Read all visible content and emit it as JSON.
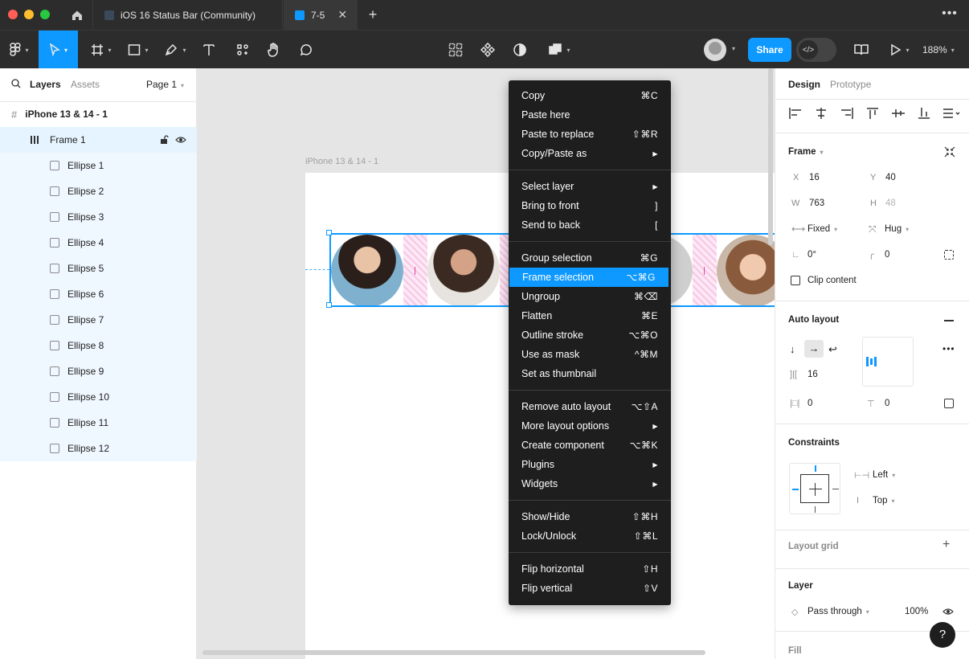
{
  "window": {
    "tabs": [
      {
        "label": "iOS 16 Status Bar (Community)",
        "active": false
      },
      {
        "label": "7-5",
        "active": true
      }
    ]
  },
  "toolbar": {
    "share_label": "Share",
    "zoom": "188%"
  },
  "layers_panel": {
    "tab_layers": "Layers",
    "tab_assets": "Assets",
    "page": "Page 1",
    "root": "iPhone 13 & 14 - 1",
    "frame": "Frame 1",
    "items": [
      "Ellipse 1",
      "Ellipse 2",
      "Ellipse 3",
      "Ellipse 4",
      "Ellipse 5",
      "Ellipse 6",
      "Ellipse 7",
      "Ellipse 8",
      "Ellipse 9",
      "Ellipse 10",
      "Ellipse 11",
      "Ellipse 12"
    ]
  },
  "canvas": {
    "frame_label": "iPhone 13 & 14 - 1"
  },
  "context_menu": {
    "groups": [
      [
        {
          "label": "Copy",
          "shortcut": "⌘C"
        },
        {
          "label": "Paste here",
          "shortcut": ""
        },
        {
          "label": "Paste to replace",
          "shortcut": "⇧⌘R"
        },
        {
          "label": "Copy/Paste as",
          "shortcut": "▶"
        }
      ],
      [
        {
          "label": "Select layer",
          "shortcut": "▶"
        },
        {
          "label": "Bring to front",
          "shortcut": "]"
        },
        {
          "label": "Send to back",
          "shortcut": "["
        }
      ],
      [
        {
          "label": "Group selection",
          "shortcut": "⌘G"
        },
        {
          "label": "Frame selection",
          "shortcut": "⌥⌘G",
          "highlighted": true
        },
        {
          "label": "Ungroup",
          "shortcut": "⌘⌫"
        },
        {
          "label": "Flatten",
          "shortcut": "⌘E"
        },
        {
          "label": "Outline stroke",
          "shortcut": "⌥⌘O"
        },
        {
          "label": "Use as mask",
          "shortcut": "^⌘M"
        },
        {
          "label": "Set as thumbnail",
          "shortcut": ""
        }
      ],
      [
        {
          "label": "Remove auto layout",
          "shortcut": "⌥⇧A"
        },
        {
          "label": "More layout options",
          "shortcut": "▶"
        },
        {
          "label": "Create component",
          "shortcut": "⌥⌘K"
        },
        {
          "label": "Plugins",
          "shortcut": "▶"
        },
        {
          "label": "Widgets",
          "shortcut": "▶"
        }
      ],
      [
        {
          "label": "Show/Hide",
          "shortcut": "⇧⌘H"
        },
        {
          "label": "Lock/Unlock",
          "shortcut": "⇧⌘L"
        }
      ],
      [
        {
          "label": "Flip horizontal",
          "shortcut": "⇧H"
        },
        {
          "label": "Flip vertical",
          "shortcut": "⇧V"
        }
      ]
    ]
  },
  "design_panel": {
    "tab_design": "Design",
    "tab_prototype": "Prototype",
    "frame_title": "Frame",
    "x_label": "X",
    "x": "16",
    "y_label": "Y",
    "y": "40",
    "w_label": "W",
    "w": "763",
    "h_label": "H",
    "h": "48",
    "width_mode": "Fixed",
    "height_mode": "Hug",
    "rotation": "0°",
    "radius": "0",
    "clip_content": "Clip content",
    "auto_layout_title": "Auto layout",
    "gap": "16",
    "padding_h": "0",
    "padding_v": "0",
    "constraints_title": "Constraints",
    "constraint_h": "Left",
    "constraint_v": "Top",
    "layout_grid_title": "Layout grid",
    "layer_title": "Layer",
    "blend_mode": "Pass through",
    "opacity": "100%",
    "fill_title": "Fill",
    "help": "?"
  },
  "colors": {
    "accent": "#0d99ff",
    "dark_chrome": "#2c2c2c",
    "menu_bg": "#1e1e1e",
    "selection_tint": "#e5f4ff"
  }
}
